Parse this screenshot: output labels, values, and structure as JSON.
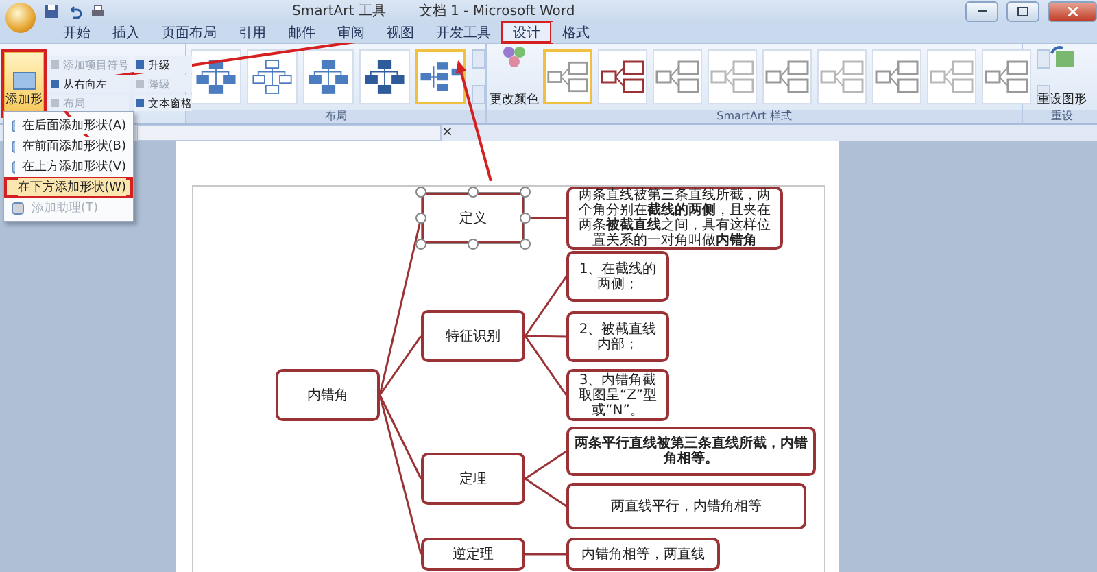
{
  "title_bar": {
    "context_title": "SmartArt 工具",
    "title": "文档 1 - Microsoft Word"
  },
  "tabs": [
    {
      "label": "开始",
      "selected": false,
      "highlighted": false
    },
    {
      "label": "插入",
      "selected": false,
      "highlighted": false
    },
    {
      "label": "页面布局",
      "selected": false,
      "highlighted": false
    },
    {
      "label": "引用",
      "selected": false,
      "highlighted": false
    },
    {
      "label": "邮件",
      "selected": false,
      "highlighted": false
    },
    {
      "label": "审阅",
      "selected": false,
      "highlighted": false
    },
    {
      "label": "视图",
      "selected": false,
      "highlighted": false
    },
    {
      "label": "开发工具",
      "selected": false,
      "highlighted": false
    },
    {
      "label": "设计",
      "selected": true,
      "highlighted": true
    },
    {
      "label": "格式",
      "selected": false,
      "highlighted": false
    }
  ],
  "ribbon": {
    "create_group": {
      "add_shape": {
        "label": "添加形",
        "highlighted": true
      },
      "commands": [
        {
          "label": "添加项目符号",
          "disabled": true
        },
        {
          "label": "从右向左",
          "disabled": false
        },
        {
          "label": "布局",
          "disabled": true
        },
        {
          "label": "升级",
          "disabled": false
        },
        {
          "label": "降级",
          "disabled": true
        },
        {
          "label": "文本窗格",
          "disabled": false
        }
      ]
    },
    "layout_group": {
      "label": "布局",
      "layouts": [
        {
          "selected": false
        },
        {
          "selected": false
        },
        {
          "selected": false
        },
        {
          "selected": false
        },
        {
          "selected": true
        }
      ]
    },
    "styles_group": {
      "label": "SmartArt 样式",
      "change_colors": "更改颜色",
      "styles": [
        {
          "selected": true
        },
        {
          "selected": false
        },
        {
          "selected": false
        },
        {
          "selected": false
        },
        {
          "selected": false
        },
        {
          "selected": false
        },
        {
          "selected": false
        },
        {
          "selected": false
        },
        {
          "selected": false
        }
      ]
    },
    "reset_group": {
      "label": "重设",
      "reset_button": "重设图形"
    }
  },
  "shape_menu": [
    {
      "label": "在后面添加形状(A)",
      "disabled": false,
      "highlighted": false
    },
    {
      "label": "在前面添加形状(B)",
      "disabled": false,
      "highlighted": false
    },
    {
      "label": "在上方添加形状(V)",
      "disabled": false,
      "highlighted": false
    },
    {
      "label": "在下方添加形状(W)",
      "disabled": false,
      "highlighted": true
    },
    {
      "label": "添加助理(T)",
      "disabled": true,
      "highlighted": false
    }
  ],
  "document_tab": {
    "close": "×"
  },
  "diagram": {
    "root": {
      "text": "内错角",
      "children": [
        {
          "text": "定义",
          "selected": true,
          "children": [
            {
              "text": "两条直线被第三条直线所截，两个角分别在**截线的两侧**，且夹在两条**被截直线**之间，具有这样位置关系的一对角叫做**内错角**",
              "bold": false
            }
          ]
        },
        {
          "text": "特征识别",
          "selected": false,
          "children": [
            {
              "text": "1、在截线的两侧；",
              "bold": false
            },
            {
              "text": "2、被截直线内部；",
              "bold": false
            },
            {
              "text": "3、内错角截取图呈“Z”型或“N”。",
              "bold": false
            }
          ]
        },
        {
          "text": "定理",
          "selected": false,
          "children": [
            {
              "text": "两条平行直线被第三条直线所截，内错角相等。",
              "bold": true
            },
            {
              "text": "两直线平行，内错角相等",
              "bold": false
            }
          ]
        },
        {
          "text": "逆定理",
          "selected": false,
          "children": [
            {
              "text": "内错角相等，两直线",
              "bold": false
            }
          ]
        }
      ]
    }
  }
}
